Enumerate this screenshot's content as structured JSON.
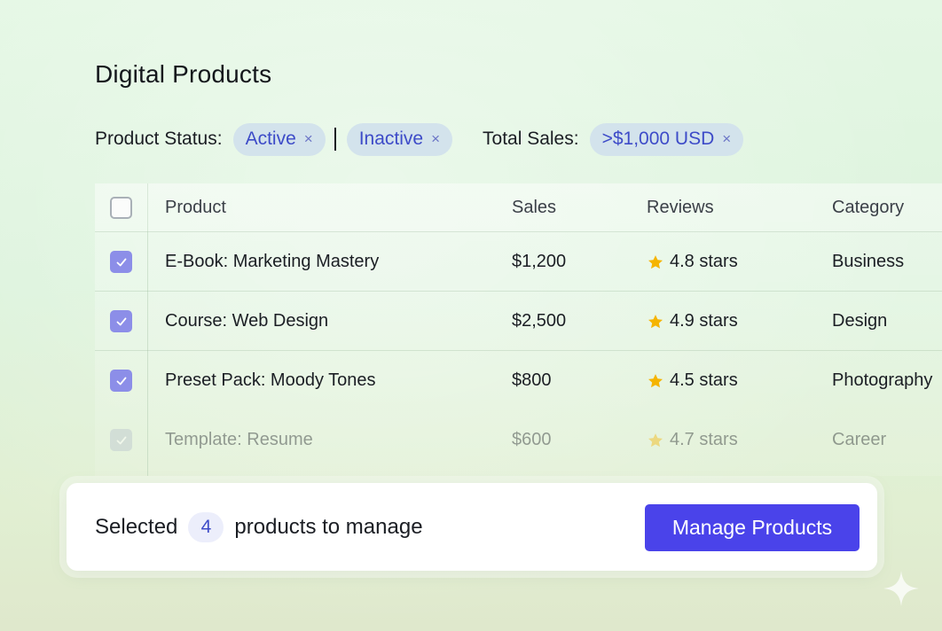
{
  "page": {
    "title": "Digital Products"
  },
  "filters": {
    "status_label": "Product Status:",
    "status_chips": [
      {
        "label": "Active",
        "remove": "×"
      },
      {
        "label": "Inactive",
        "remove": "×"
      }
    ],
    "sales_label": "Total Sales:",
    "sales_chip": {
      "label": ">$1,000 USD",
      "remove": "×"
    }
  },
  "table": {
    "columns": [
      "Product",
      "Sales",
      "Reviews",
      "Category"
    ],
    "select_all_checked": false,
    "rows": [
      {
        "checked": true,
        "product": "E-Book: Marketing Mastery",
        "sales": "$1,200",
        "reviews": "4.8 stars",
        "category": "Business"
      },
      {
        "checked": true,
        "product": "Course: Web Design",
        "sales": "$2,500",
        "reviews": "4.9 stars",
        "category": "Design"
      },
      {
        "checked": true,
        "product": "Preset Pack: Moody Tones",
        "sales": "$800",
        "reviews": "4.5 stars",
        "category": "Photography"
      },
      {
        "checked": true,
        "product": "Template: Resume",
        "sales": "$600",
        "reviews": "4.7 stars",
        "category": "Career"
      }
    ]
  },
  "selection_bar": {
    "prefix": "Selected",
    "count": "4",
    "suffix": "products to manage",
    "button_label": "Manage Products"
  },
  "colors": {
    "accent": "#4a43ea",
    "chip_text": "#3d4bc8",
    "chip_bg": "#d3e3ec",
    "checkbox_checked": "#8c8ee8",
    "star": "#f5b400"
  },
  "icons": {
    "chip_remove": "close-icon",
    "review": "star-icon",
    "checkbox": "checkmark-icon",
    "corner": "sparkle-icon"
  }
}
